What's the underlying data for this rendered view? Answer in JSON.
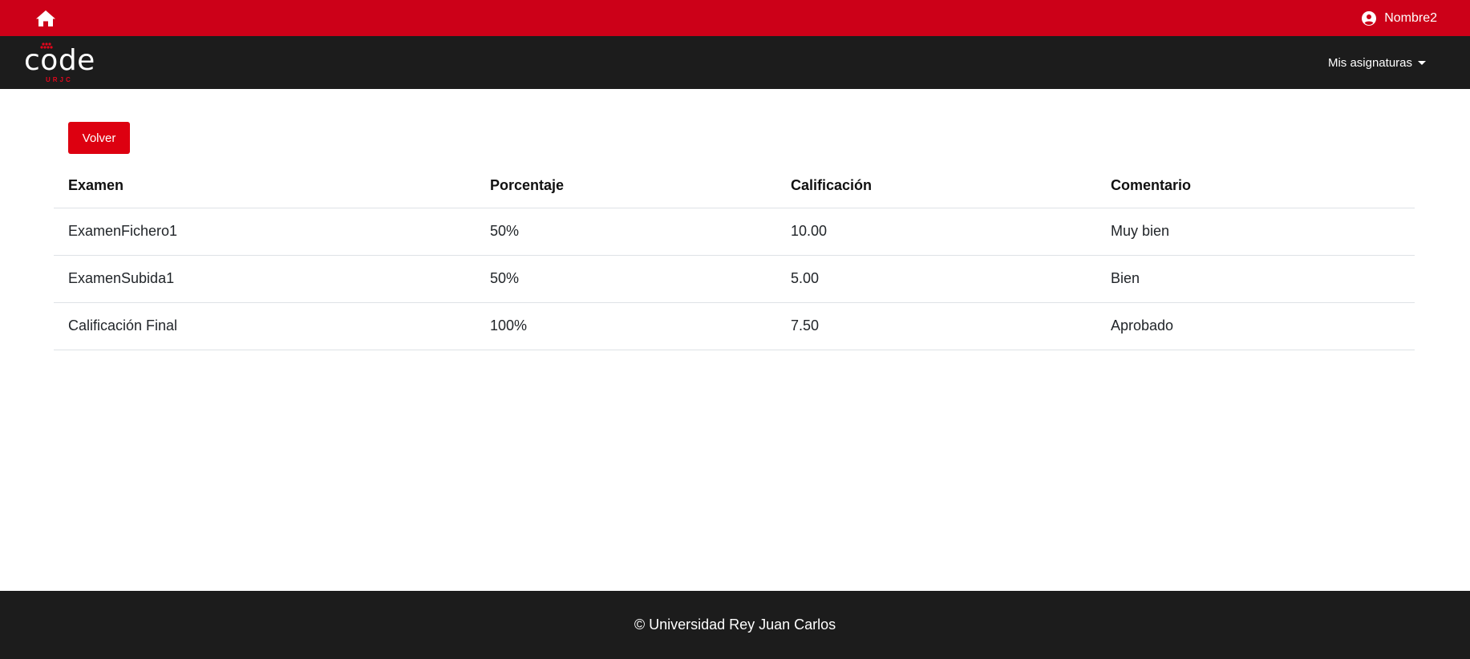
{
  "topbar": {
    "home_icon": "home-icon",
    "user_icon": "user-circle-icon",
    "user_name": "Nombre2",
    "color": "#cc0018"
  },
  "navbar": {
    "logo_text": "code",
    "logo_sub": "URJC",
    "menu_label": "Mis asignaturas",
    "color": "#1c1c1c"
  },
  "main": {
    "back_button": "Volver",
    "table": {
      "headers": [
        "Examen",
        "Porcentaje",
        "Calificación",
        "Comentario"
      ],
      "rows": [
        [
          "ExamenFichero1",
          "50%",
          "10.00",
          "Muy bien"
        ],
        [
          "ExamenSubida1",
          "50%",
          "5.00",
          "Bien"
        ],
        [
          "Calificación Final",
          "100%",
          "7.50",
          "Aprobado"
        ]
      ]
    }
  },
  "footer": {
    "text": "© Universidad Rey Juan Carlos"
  },
  "colors": {
    "accent": "#dd0010",
    "logo_red": "#e3061c"
  }
}
